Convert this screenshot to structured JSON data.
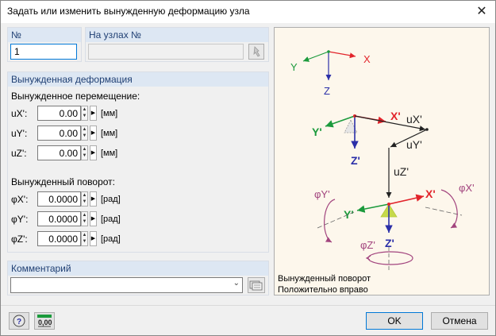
{
  "window": {
    "title": "Задать или изменить вынужденную деформацию узла"
  },
  "top": {
    "number_label": "№",
    "number_value": "1",
    "nodes_label": "На узлах №",
    "nodes_value": ""
  },
  "deformation": {
    "header": "Вынужденная деформация",
    "displacement_title": "Вынужденное перемещение:",
    "displacements": [
      {
        "label": "uX':",
        "value": "0.00",
        "unit": "[мм]"
      },
      {
        "label": "uY':",
        "value": "0.00",
        "unit": "[мм]"
      },
      {
        "label": "uZ':",
        "value": "0.00",
        "unit": "[мм]"
      }
    ],
    "rotation_title": "Вынужденный поворот:",
    "rotations": [
      {
        "label": "φX':",
        "value": "0.0000",
        "unit": "[рад]"
      },
      {
        "label": "φY':",
        "value": "0.0000",
        "unit": "[рад]"
      },
      {
        "label": "φZ':",
        "value": "0.0000",
        "unit": "[рад]"
      }
    ]
  },
  "comment": {
    "header": "Комментарий",
    "value": ""
  },
  "diagram": {
    "global_axes": {
      "x": "X",
      "y": "Y",
      "z": "Z"
    },
    "local_axes_top": {
      "x": "X'",
      "y": "Y'",
      "z": "Z'"
    },
    "displacement_labels": {
      "ux": "uX'",
      "uy": "uY'",
      "uz": "uZ'"
    },
    "local_axes_bottom": {
      "x": "X'",
      "y": "Y'",
      "z": "Z'"
    },
    "rotation_labels": {
      "phix": "φX'",
      "phiy": "φY'",
      "phiz": "φZ'"
    },
    "caption_line1": "Вынужденный поворот",
    "caption_line2": "Положительно вправо",
    "colors": {
      "x_axis": "#e2242b",
      "y_axis": "#1b9a3c",
      "z_axis": "#2b2fa8",
      "rotation": "#a2447e",
      "support": "#c6d94a"
    }
  },
  "footer": {
    "ok_label": "OK",
    "cancel_label": "Отмена",
    "units_icon_text": "0,00"
  }
}
